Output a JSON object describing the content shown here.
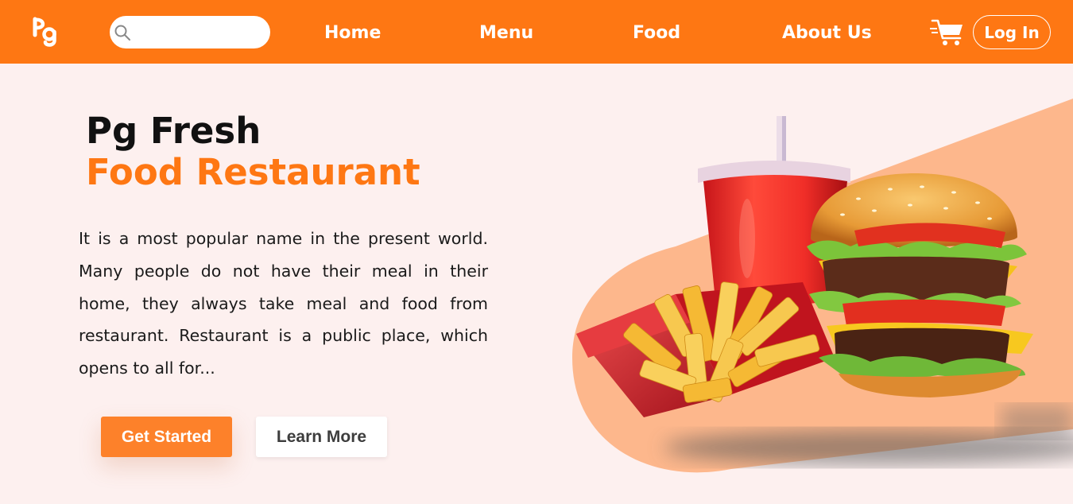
{
  "navbar": {
    "logo_text": "Pg",
    "search": {
      "placeholder": "",
      "value": ""
    },
    "links": [
      {
        "label": "Home"
      },
      {
        "label": "Menu"
      },
      {
        "label": "Food"
      },
      {
        "label": "About Us"
      }
    ],
    "cart_icon": "shopping-cart-icon",
    "login_label": "Log In"
  },
  "hero": {
    "title_line1": "Pg Fresh",
    "title_line2": "Food Restaurant",
    "description": "It is a most popular name in the present world. Many people do not have their meal in their home, they always take meal and food from restaurant. Restaurant is a public place, which opens to all for...",
    "primary_button": "Get Started",
    "secondary_button": "Learn More",
    "image": "burger-fries-drink-illustration"
  },
  "colors": {
    "brand_orange": "#fe7713",
    "page_background": "#fdf0ef",
    "accent_stripe": "#fdb78c"
  }
}
